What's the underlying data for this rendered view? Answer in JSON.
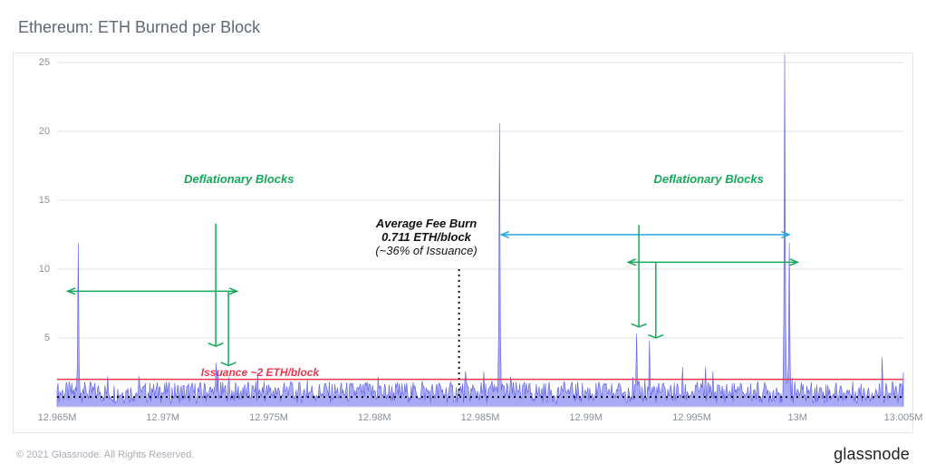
{
  "title": "Ethereum: ETH Burned per Block",
  "copyright": "© 2021 Glassnode. All Rights Reserved.",
  "brand": "glassnode",
  "annotations": {
    "deflationary1": "Deflationary\nBlocks",
    "deflationary2": "Deflationary\nBlocks",
    "avgfee_l1": "Average Fee Burn",
    "avgfee_l2": "0.711 ETH/block",
    "avgfee_l3": "(~36% of Issuance)",
    "issuance": "Issuance ~2 ETH/block"
  },
  "chart_data": {
    "type": "line",
    "title": "Ethereum: ETH Burned per Block",
    "xlabel": "",
    "ylabel": "",
    "xlim": [
      12.965,
      13.005
    ],
    "ylim": [
      0,
      25
    ],
    "x_ticks": [
      "12.965M",
      "12.97M",
      "12.975M",
      "12.98M",
      "12.985M",
      "12.99M",
      "12.995M",
      "13M",
      "13.005M"
    ],
    "y_ticks": [
      5,
      10,
      15,
      20,
      25
    ],
    "series": [
      {
        "name": "ETH Burned per Block",
        "color": "#6a6cf0",
        "x": [
          12.965,
          12.9654,
          12.9656,
          12.966,
          12.9662,
          12.9664,
          12.967,
          12.968,
          12.969,
          12.97,
          12.971,
          12.972,
          12.9725,
          12.9726,
          12.973,
          12.974,
          12.975,
          12.976,
          12.977,
          12.978,
          12.979,
          12.98,
          12.981,
          12.982,
          12.983,
          12.984,
          12.985,
          12.9859,
          12.986,
          12.9865,
          12.987,
          12.988,
          12.989,
          12.99,
          12.991,
          12.992,
          12.9924,
          12.9928,
          12.993,
          12.9932,
          12.994,
          12.995,
          12.996,
          12.997,
          12.998,
          12.999,
          12.9994,
          12.9996,
          13.0,
          13.0005,
          13.001,
          13.002,
          13.003,
          13.004,
          13.005
        ],
        "values": [
          0.8,
          1.0,
          1.5,
          11.9,
          1.3,
          1.0,
          0.9,
          0.8,
          1.1,
          0.9,
          1.0,
          1.6,
          3.2,
          2.4,
          1.0,
          0.9,
          0.8,
          1.0,
          1.1,
          0.9,
          1.0,
          1.2,
          1.0,
          0.9,
          0.8,
          1.0,
          1.1,
          20.6,
          1.2,
          1.0,
          0.9,
          1.1,
          1.0,
          0.9,
          1.1,
          1.4,
          5.3,
          2.0,
          4.8,
          1.5,
          1.0,
          0.9,
          1.0,
          1.1,
          1.2,
          1.4,
          25.6,
          11.9,
          1.3,
          1.0,
          0.9,
          1.1,
          1.5,
          3.6,
          2.5
        ]
      },
      {
        "name": "Issuance ~2 ETH/block",
        "color": "#e73850",
        "x": [
          12.965,
          13.005
        ],
        "values": [
          2,
          2
        ]
      },
      {
        "name": "Average Fee Burn",
        "color": "#000000",
        "style": "dotted",
        "x": [
          12.965,
          13.005
        ],
        "values": [
          0.711,
          0.711
        ]
      }
    ]
  }
}
